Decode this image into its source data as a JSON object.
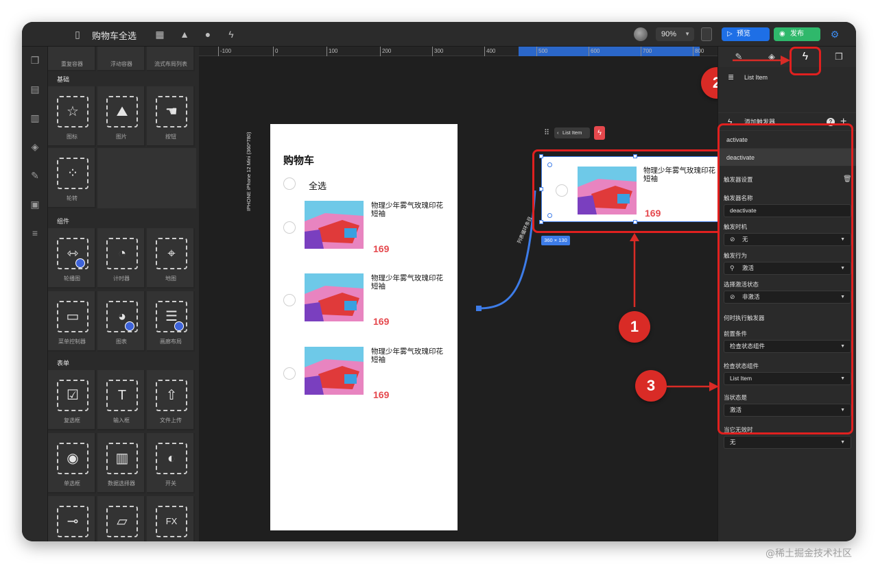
{
  "window": {
    "title": "购物车全选",
    "zoom": "90%"
  },
  "header": {
    "preview_label": "预览",
    "publish_label": "发布"
  },
  "component_panel": {
    "top_items": [
      "重复容器",
      "浮动容器",
      "流式布局列表"
    ],
    "sections": [
      {
        "title": "基础",
        "items": [
          "图标",
          "图片",
          "按钮",
          "轮转"
        ]
      },
      {
        "title": "组件",
        "items": [
          "轮播图",
          "计时器",
          "地图",
          "菜单控制器",
          "图表",
          "画廊布局"
        ]
      },
      {
        "title": "表单",
        "items": [
          "复选框",
          "输入框",
          "文件上传",
          "单选框",
          "数据选择器",
          "开关"
        ]
      }
    ]
  },
  "ruler": {
    "ticks": [
      "-100",
      "0",
      "100",
      "200",
      "300",
      "400",
      "500",
      "600",
      "700",
      "800"
    ]
  },
  "phone": {
    "device_label": "IPHONE    iPhone 12 Mini (360*780)",
    "title": "购物车",
    "select_all": "全选",
    "products": [
      {
        "name": "物理少年雾气玫瑰印花短袖",
        "price": "169"
      },
      {
        "name": "物理少年雾气玫瑰印花短袖",
        "price": "169"
      },
      {
        "name": "物理少年雾气玫瑰印花短袖",
        "price": "169"
      }
    ]
  },
  "selection": {
    "toolbar_label": "List Item",
    "size_badge": "360 × 130",
    "connector_label": "列表循环条目",
    "item_name": "物理少年雾气玫瑰印花短袖",
    "item_price": "169"
  },
  "annotations": [
    "1",
    "2",
    "3"
  ],
  "props": {
    "component_name": "List Item",
    "add_trigger": "添加触发器",
    "triggers": [
      "activate",
      "deactivate"
    ],
    "settings_title": "触发器设置",
    "name_label": "触发器名称",
    "name_value": "deactivate",
    "timing_label": "触发时机",
    "timing_value": "无",
    "action_label": "触发行为",
    "action_value": "激活",
    "state_label": "选择激活状态",
    "state_value": "非激活",
    "when_title": "何时执行触发器",
    "precondition_label": "前置条件",
    "precondition_value": "检查状态组件",
    "check_component_label": "检查状态组件",
    "check_component_value": "List Item",
    "when_state_label": "当状态是",
    "when_state_value": "激活",
    "when_invalid_label": "当它无效时",
    "when_invalid_value": "无"
  },
  "watermark": "@稀土掘金技术社区",
  "colors": {
    "accent_blue": "#1e6fe6",
    "publish_green": "#2fb86b",
    "annotation_red": "#e0201f",
    "price_red": "#e5484d"
  }
}
